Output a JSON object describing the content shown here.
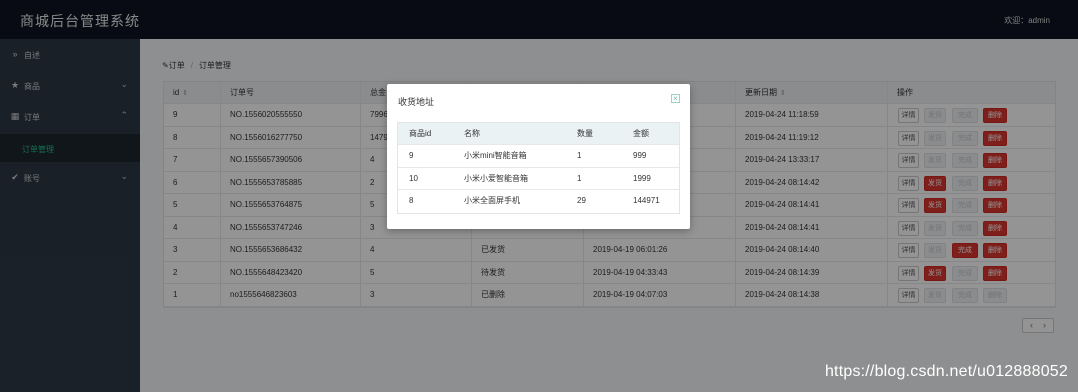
{
  "header": {
    "title": "商城后台管理系统",
    "welcome": "欢迎：admin"
  },
  "sidebar": {
    "items": [
      {
        "label": "自述",
        "icon": "double-chevron-right-icon",
        "glyph": "»"
      },
      {
        "label": "商品",
        "icon": "star-icon",
        "glyph": "★",
        "chevron": "⌄"
      },
      {
        "label": "订单",
        "icon": "grid-icon",
        "glyph": "▦",
        "chevron": "⌃"
      },
      {
        "label": "账号",
        "icon": "check-circle-icon",
        "glyph": "✔",
        "chevron": "⌄"
      }
    ],
    "sub": {
      "label": "订单管理"
    }
  },
  "breadcrumb": {
    "icon": "pencil-icon",
    "glyph": "✎",
    "root": "订单",
    "sep": "/",
    "current": "订单管理"
  },
  "table": {
    "headers": [
      "id",
      "订单号",
      "总金",
      "",
      "",
      "更新日期",
      "操作"
    ],
    "sort_glyph": "⇕",
    "rows": [
      {
        "id": "9",
        "no": "NO.1556020555550",
        "total": "7996",
        "status": "",
        "created": "",
        "updated": "2019-04-24 11:18:59",
        "ship": "dis",
        "done": "dis",
        "del": "red"
      },
      {
        "id": "8",
        "no": "NO.1556016277750",
        "total": "1479",
        "status": "",
        "created": "",
        "updated": "2019-04-24 11:19:12",
        "ship": "dis",
        "done": "dis",
        "del": "red"
      },
      {
        "id": "7",
        "no": "NO.1555657390506",
        "total": "4",
        "status": "",
        "created": "",
        "updated": "2019-04-24 13:33:17",
        "ship": "dis",
        "done": "dis",
        "del": "red"
      },
      {
        "id": "6",
        "no": "NO.1555653785885",
        "total": "2",
        "status": "",
        "created": "",
        "updated": "2019-04-24 08:14:42",
        "ship": "red",
        "done": "dis",
        "del": "red"
      },
      {
        "id": "5",
        "no": "NO.1555653764875",
        "total": "5",
        "status": "",
        "created": "",
        "updated": "2019-04-24 08:14:41",
        "ship": "red",
        "done": "dis",
        "del": "red"
      },
      {
        "id": "4",
        "no": "NO.1555653747246",
        "total": "3",
        "status": "",
        "created": "",
        "updated": "2019-04-24 08:14:41",
        "ship": "dis",
        "done": "dis",
        "del": "red"
      },
      {
        "id": "3",
        "no": "NO.1555653686432",
        "total": "4",
        "status": "已发货",
        "created": "2019-04-19 06:01:26",
        "updated": "2019-04-24 08:14:40",
        "ship": "dis",
        "done": "red",
        "del": "red"
      },
      {
        "id": "2",
        "no": "NO.1555648423420",
        "total": "5",
        "status": "待发货",
        "created": "2019-04-19 04:33:43",
        "updated": "2019-04-24 08:14:39",
        "ship": "red",
        "done": "dis",
        "del": "red"
      },
      {
        "id": "1",
        "no": "no1555646823603",
        "total": "3",
        "status": "已删除",
        "created": "2019-04-19 04:07:03",
        "updated": "2019-04-24 08:14:38",
        "ship": "dis",
        "done": "dis",
        "del": "dis"
      }
    ],
    "btn_labels": {
      "detail": "详情",
      "ship": "发货",
      "done": "完成",
      "del": "删除"
    }
  },
  "pager": {
    "prev": "‹",
    "next": "›"
  },
  "modal": {
    "title": "收货地址",
    "close": "×",
    "headers": [
      "商品id",
      "名称",
      "数量",
      "金额"
    ],
    "rows": [
      [
        "9",
        "小米mini智能音箱",
        "1",
        "999"
      ],
      [
        "10",
        "小米小爱智能音箱",
        "1",
        "1999"
      ],
      [
        "8",
        "小米全面屏手机",
        "29",
        "144971"
      ]
    ]
  },
  "watermark": "https://blog.csdn.net/u012888052",
  "colors": {
    "header_bg": "#0f1423",
    "sidebar_bg": "#2c3845",
    "accent": "#27c08a",
    "danger": "#d9362f"
  }
}
